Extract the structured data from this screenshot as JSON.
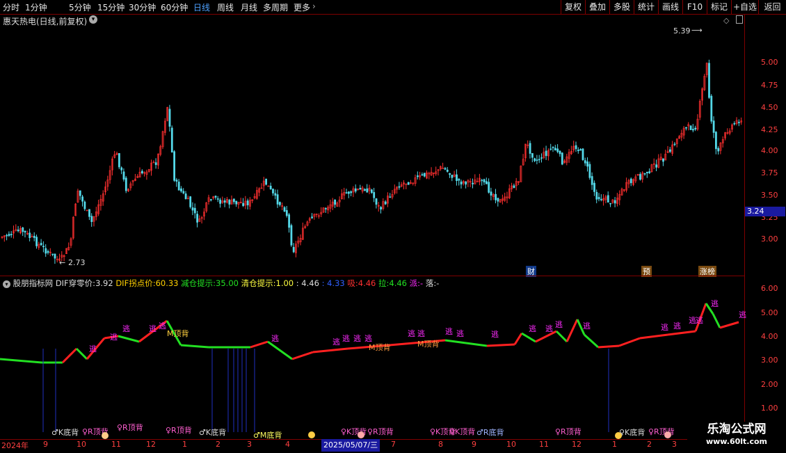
{
  "toolbar": {
    "periods": [
      "分时",
      "1分钟",
      "5分钟",
      "15分钟",
      "30分钟",
      "60分钟",
      "日线",
      "周线",
      "月线",
      "多周期",
      "更多"
    ],
    "right": [
      "复权",
      "叠加",
      "多股",
      "统计",
      "画线",
      "F10",
      "标记",
      "+自选",
      "返回"
    ]
  },
  "stock": {
    "title": "惠天热电(日线,前复权)",
    "high": "5.39",
    "low": "2.73",
    "last": "3.24"
  },
  "price_axis": [
    "5.00",
    "4.75",
    "4.50",
    "4.25",
    "4.00",
    "3.75",
    "3.50",
    "3.25",
    "3.00"
  ],
  "events": [
    "财",
    "预",
    "涨榜"
  ],
  "indicator": {
    "name": "股朋指标网",
    "dif_label": "DIF穿零价:",
    "dif_value": "3.92",
    "turn_label": "DIF拐点价:",
    "turn_value": "60.33",
    "reduce_label": "减仓提示:",
    "reduce_value": "35.00",
    "clear_label": "清仓提示:",
    "clear_value": "1.00",
    "x1": ": 4.46",
    "x2": ": 4.33",
    "xi_label": "吸:",
    "xi_value": "4.46",
    "la_label": "拉:",
    "la_value": "4.46",
    "pai_label": "派:",
    "pai_value": "-",
    "luo_label": "落:",
    "luo_value": "-"
  },
  "indicator_axis": [
    "6.00",
    "5.00",
    "4.00",
    "3.00",
    "2.00",
    "1.00"
  ],
  "signals": [
    "♂K底背",
    "♀R顶背",
    "♀R顶背",
    "♀R顶背",
    "♂K底背",
    "♂M底背",
    "♀K顶背",
    "♀R顶背",
    "♀K顶背",
    "♀K顶背",
    "♂R底背",
    "♀R顶背",
    "♀K底背",
    "♀R顶背"
  ],
  "markers": [
    "逃",
    "M顶背",
    "M顶背",
    "M顶背"
  ],
  "dates": [
    "2024年",
    "9",
    "10",
    "11",
    "12",
    "1",
    "2",
    "3",
    "4",
    "2025/05/07/三",
    "7",
    "8",
    "9",
    "10",
    "11",
    "12",
    "1",
    "2",
    "3"
  ],
  "watermark": {
    "title": "乐淘公式网",
    "url": "www.60lt.com"
  },
  "colors": {
    "up": "#ff3030",
    "down": "#54d8e8",
    "axis": "#ff4040",
    "grid": "#800000",
    "active": "#4ea1ff"
  }
}
